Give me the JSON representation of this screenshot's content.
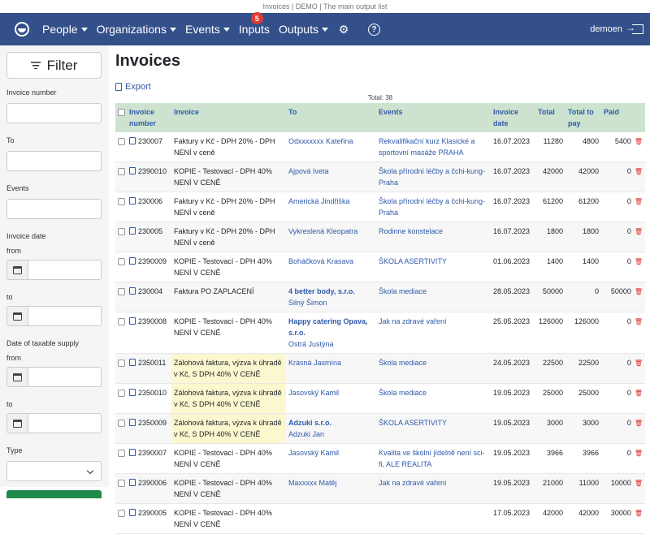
{
  "window_title": "Invoices | DEMO | The main output list",
  "nav": {
    "people": "People",
    "organizations": "Organizations",
    "events": "Events",
    "inputs": "Inputs",
    "inputs_badge": "5",
    "outputs": "Outputs",
    "user": "demoen"
  },
  "sidebar": {
    "filter": "Filter",
    "invoice_number": "Invoice number",
    "to": "To",
    "events": "Events",
    "invoice_date": "Invoice date",
    "from1": "from",
    "to1": "to",
    "taxable": "Date of taxable supply",
    "from2": "from",
    "to2": "to",
    "type": "Type"
  },
  "main": {
    "title": "Invoices",
    "export": "Export",
    "total": "Total: 38"
  },
  "columns": [
    "Invoice number",
    "Invoice",
    "To",
    "Events",
    "Invoice date",
    "Total",
    "Total to pay",
    "Paid"
  ],
  "rows": [
    {
      "num": "230007",
      "inv": "Faktury v Kč - DPH 20% - DPH NENÍ v ceně",
      "to": "Odxxxxxxx Kateřina",
      "to2": "",
      "ev": "Rekvalifikační kurz Klasické a sportovní masáže PRAHA",
      "date": "16.07.2023",
      "total": "11280",
      "topay": "4800",
      "paid": "5400",
      "hl": false,
      "bold": false
    },
    {
      "num": "2390010",
      "inv": "KOPIE - Testovací - DPH 40% NENÍ V CENĚ",
      "to": "Ajpová Iveta",
      "to2": "",
      "ev": "Škola přírodní léčby a čchi-kung-Praha",
      "date": "16.07.2023",
      "total": "42000",
      "topay": "42000",
      "paid": "0",
      "hl": false,
      "bold": false
    },
    {
      "num": "230006",
      "inv": "Faktury v Kč - DPH 20% - DPH NENÍ v ceně",
      "to": "Americká Jindřiška",
      "to2": "",
      "ev": "Škola přírodní léčby a čchi-kung-Praha",
      "date": "16.07.2023",
      "total": "61200",
      "topay": "61200",
      "paid": "0",
      "hl": false,
      "bold": false
    },
    {
      "num": "230005",
      "inv": "Faktury v Kč - DPH 20% - DPH NENÍ v ceně",
      "to": "Vykreslená Kleopatra",
      "to2": "",
      "ev": "Rodinne konstelace",
      "date": "16.07.2023",
      "total": "1800",
      "topay": "1800",
      "paid": "0",
      "hl": false,
      "bold": false
    },
    {
      "num": "2390009",
      "inv": "KOPIE - Testovací - DPH 40% NENÍ V CENĚ",
      "to": "Boháčková Krasava",
      "to2": "",
      "ev": "ŠKOLA ASERTIVITY",
      "date": "01.06.2023",
      "total": "1400",
      "topay": "1400",
      "paid": "0",
      "hl": false,
      "bold": false
    },
    {
      "num": "230004",
      "inv": "Faktura PO ZAPLACENÍ",
      "to": "4 better body, s.r.o.",
      "to2": "Silný Šimon",
      "ev": "Škola mediace",
      "date": "28.05.2023",
      "total": "50000",
      "topay": "0",
      "paid": "50000",
      "hl": false,
      "bold": true
    },
    {
      "num": "2390008",
      "inv": "KOPIE - Testovací - DPH 40% NENÍ V CENĚ",
      "to": "Happy catering Opava, s.r.o.",
      "to2": "Ostrá Justýna",
      "ev": "Jak na zdravé vaření",
      "date": "25.05.2023",
      "total": "126000",
      "topay": "126000",
      "paid": "0",
      "hl": false,
      "bold": true
    },
    {
      "num": "2350011",
      "inv": "Zálohová faktura, výzva k úhradě v Kč, S DPH 40% V CENĚ",
      "to": "Krásná Jasmína",
      "to2": "",
      "ev": "Škola mediace",
      "date": "24.05.2023",
      "total": "22500",
      "topay": "22500",
      "paid": "0",
      "hl": true,
      "bold": false
    },
    {
      "num": "2350010",
      "inv": "Zálohová faktura, výzva k úhradě v Kč, S DPH 40% V CENĚ",
      "to": "Jasovský Kamil",
      "to2": "",
      "ev": "Škola mediace",
      "date": "19.05.2023",
      "total": "25000",
      "topay": "25000",
      "paid": "0",
      "hl": true,
      "bold": false
    },
    {
      "num": "2350009",
      "inv": "Zálohová faktura, výzva k úhradě v Kč, S DPH 40% V CENĚ",
      "to": "Adzuki s.r.o.",
      "to2": "Adzuki Jan",
      "ev": "ŠKOLA ASERTIVITY",
      "date": "19.05.2023",
      "total": "3000",
      "topay": "3000",
      "paid": "0",
      "hl": true,
      "bold": true
    },
    {
      "num": "2390007",
      "inv": "KOPIE - Testovací - DPH 40% NENÍ V CENĚ",
      "to": "Jasovský Kamil",
      "to2": "",
      "ev": "Kvalita ve školní jídelně není sci-fi, ALE REALITA",
      "date": "19.05.2023",
      "total": "3966",
      "topay": "3966",
      "paid": "0",
      "hl": false,
      "bold": false
    },
    {
      "num": "2390006",
      "inv": "KOPIE - Testovací - DPH 40% NENÍ V CENĚ",
      "to": "Maxxxxx Matěj",
      "to2": "",
      "ev": "Jak na zdravé vaření",
      "date": "19.05.2023",
      "total": "21000",
      "topay": "11000",
      "paid": "10000",
      "hl": false,
      "bold": false
    },
    {
      "num": "2390005",
      "inv": "KOPIE - Testovací - DPH 40% NENÍ V CENĚ",
      "to": "",
      "to2": "",
      "ev": "",
      "date": "17.05.2023",
      "total": "42000",
      "topay": "42000",
      "paid": "30000",
      "hl": false,
      "bold": false
    }
  ]
}
